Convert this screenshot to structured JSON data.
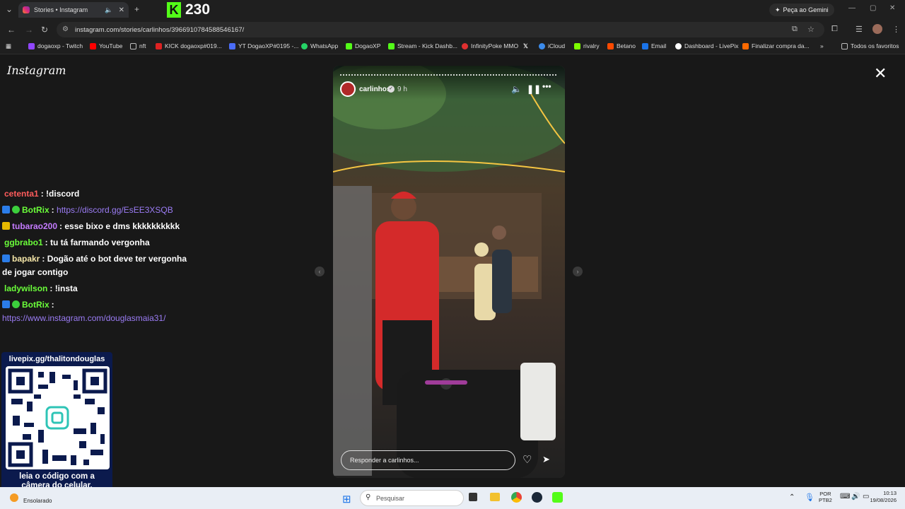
{
  "browser": {
    "tab_title": "Stories • Instagram",
    "kick_logo": "K",
    "kick_count": "230",
    "gemini_label": "Peça ao Gemini",
    "url": "instagram.com/stories/carlinhos/3966910784588546167/"
  },
  "bookmarks": [
    {
      "label": "dogaoxp - Twitch",
      "color": "#9146ff"
    },
    {
      "label": "YouTube",
      "color": "#ff0000"
    },
    {
      "label": "nft",
      "color": "#888888"
    },
    {
      "label": "KICK dogaoxp#019...",
      "color": "#53fc18"
    },
    {
      "label": "YT DogaoXP#0195 -...",
      "color": "#4a6cf7"
    },
    {
      "label": "WhatsApp",
      "color": "#25d366"
    },
    {
      "label": "DogaoXP",
      "color": "#53fc18"
    },
    {
      "label": "Stream - Kick Dashb...",
      "color": "#53fc18"
    },
    {
      "label": "InfinityPoke MMO",
      "color": "#e03030"
    },
    {
      "label": "",
      "color": "#ffffff",
      "icon": "x-icon"
    },
    {
      "label": "iCloud",
      "color": "#3b8beb"
    },
    {
      "label": "rivalry",
      "color": "#7cfc00"
    },
    {
      "label": "Betano",
      "color": "#ff4a00"
    },
    {
      "label": "Email",
      "color": "#1a73e8"
    },
    {
      "label": "Dashboard - LivePix",
      "color": "#ffffff"
    },
    {
      "label": "Finalizar compra da...",
      "color": "#ff6a00"
    }
  ],
  "bookmarks_all": "Todos os favoritos",
  "instagram": {
    "logo": "Instagram",
    "story": {
      "username": "carlinhos",
      "verified": "✓",
      "time": "9 h",
      "reply_placeholder": "Responder a carlinhos..."
    }
  },
  "chat": [
    {
      "user": "cetenta1",
      "color": "#ff5c5c",
      "text": ": !discord",
      "badges": []
    },
    {
      "user": "BotRix",
      "color": "#6bff3a",
      "text": ": ",
      "link": "https://discord.gg/EsEE3XSQB",
      "badges": [
        "#2b7de9",
        "#3ccf3c"
      ]
    },
    {
      "user": "tubarao200",
      "color": "#c57bff",
      "text": ": esse bixo e dms kkkkkkkkkk",
      "badges": [
        "#e6b800"
      ]
    },
    {
      "user": "ggbrabo1",
      "color": "#6bff3a",
      "text": ": tu tá farmando vergonha",
      "badges": []
    },
    {
      "user": "bapakr",
      "color": "#f5e6a8",
      "text": ": Dogão até o bot deve ter vergonha",
      "text2": "de jogar contigo",
      "badges": [
        "#2b7de9"
      ]
    },
    {
      "user": "ladywilson",
      "color": "#6bff3a",
      "text": ": !insta",
      "badges": []
    },
    {
      "user": "BotRix",
      "color": "#6bff3a",
      "text": ":",
      "link": "https://www.instagram.com/douglasmaia31/",
      "badges": [
        "#2b7de9",
        "#3ccf3c"
      ]
    }
  ],
  "qr": {
    "title": "livepix.gg/thalitondouglas",
    "caption_line1": "leia o código com a",
    "caption_line2": "câmera do celular."
  },
  "taskbar": {
    "weather": "Ensolarado",
    "search_placeholder": "Pesquisar",
    "lang_line1": "POR",
    "lang_line2": "PTB2",
    "time": "10:13",
    "date": "19/08/2026"
  }
}
